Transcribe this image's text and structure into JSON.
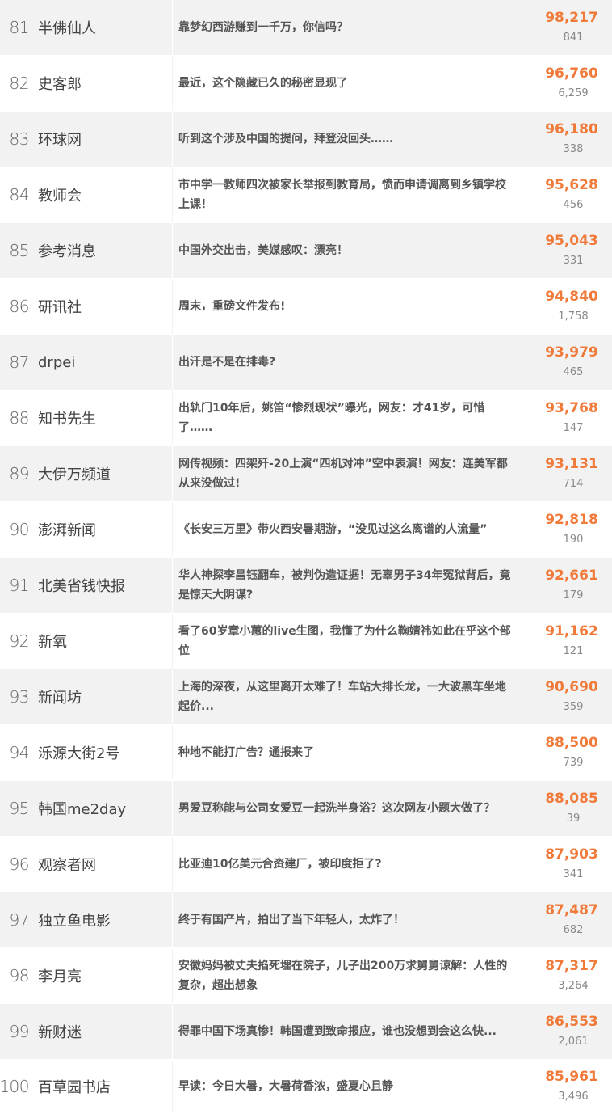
{
  "rows": [
    {
      "rank": "81",
      "source": "半佛仙人",
      "title": "靠梦幻西游赚到一千万，你信吗？",
      "views": "98,217",
      "comments": "841"
    },
    {
      "rank": "82",
      "source": "史客郎",
      "title": "最近，这个隐藏已久的秘密显现了",
      "views": "96,760",
      "comments": "6,259"
    },
    {
      "rank": "83",
      "source": "环球网",
      "title": "听到这个涉及中国的提问，拜登没回头……",
      "views": "96,180",
      "comments": "338"
    },
    {
      "rank": "84",
      "source": "教师会",
      "title": "市中学一教师四次被家长举报到教育局，愤而申请调离到乡镇学校上课！",
      "views": "95,628",
      "comments": "456"
    },
    {
      "rank": "85",
      "source": "参考消息",
      "title": "中国外交出击，美媒感叹：漂亮！",
      "views": "95,043",
      "comments": "331"
    },
    {
      "rank": "86",
      "source": "研讯社",
      "title": "周末，重磅文件发布!",
      "views": "94,840",
      "comments": "1,758"
    },
    {
      "rank": "87",
      "source": "drpei",
      "title": "出汗是不是在排毒?",
      "views": "93,979",
      "comments": "465"
    },
    {
      "rank": "88",
      "source": "知书先生",
      "title": "出轨门10年后，姚笛“惨烈现状”曝光，网友：才41岁，可惜了……",
      "views": "93,768",
      "comments": "147"
    },
    {
      "rank": "89",
      "source": "大伊万频道",
      "title": "网传视频：四架歼-20上演“四机对冲”空中表演！网友：连美军都从来没做过!",
      "views": "93,131",
      "comments": "714"
    },
    {
      "rank": "90",
      "source": "澎湃新闻",
      "title": "《长安三万里》带火西安暑期游，“没见过这么离谱的人流量”",
      "views": "92,818",
      "comments": "190"
    },
    {
      "rank": "91",
      "source": "北美省钱快报",
      "title": "华人神探李昌钰翻车，被判伪造证据！无辜男子34年冤狱背后，竟是惊天大阴谋?",
      "views": "92,661",
      "comments": "179"
    },
    {
      "rank": "92",
      "source": "新氧",
      "title": "看了60岁章小蕙的live生图，我懂了为什么鞠婧祎如此在乎这个部位",
      "views": "91,162",
      "comments": "121"
    },
    {
      "rank": "93",
      "source": "新闻坊",
      "title": "上海的深夜，从这里离开太难了！车站大排长龙，一大波黑车坐地起价...",
      "views": "90,690",
      "comments": "359"
    },
    {
      "rank": "94",
      "source": "泺源大街2号",
      "title": "种地不能打广告？通报来了",
      "views": "88,500",
      "comments": "739"
    },
    {
      "rank": "95",
      "source": "韩国me2day",
      "title": "男爱豆称能与公司女爱豆一起洗半身浴？这次网友小题大做了？",
      "views": "88,085",
      "comments": "39"
    },
    {
      "rank": "96",
      "source": "观察者网",
      "title": "比亚迪10亿美元合资建厂，被印度拒了?",
      "views": "87,903",
      "comments": "341"
    },
    {
      "rank": "97",
      "source": "独立鱼电影",
      "title": "终于有国产片，拍出了当下年轻人，太炸了！",
      "views": "87,487",
      "comments": "682"
    },
    {
      "rank": "98",
      "source": "李月亮",
      "title": "安徽妈妈被丈夫掐死埋在院子，儿子出200万求舅舅谅解：人性的复杂，超出想象",
      "views": "87,317",
      "comments": "3,264"
    },
    {
      "rank": "99",
      "source": "新财迷",
      "title": "得罪中国下场真惨！韩国遭到致命报应，谁也没想到会这么快...",
      "views": "86,553",
      "comments": "2,061"
    },
    {
      "rank": "100",
      "source": "百草园书店",
      "title": "早读：今日大暑，大暑荷香浓，盛夏心且静",
      "views": "85,961",
      "comments": "3,496"
    }
  ]
}
